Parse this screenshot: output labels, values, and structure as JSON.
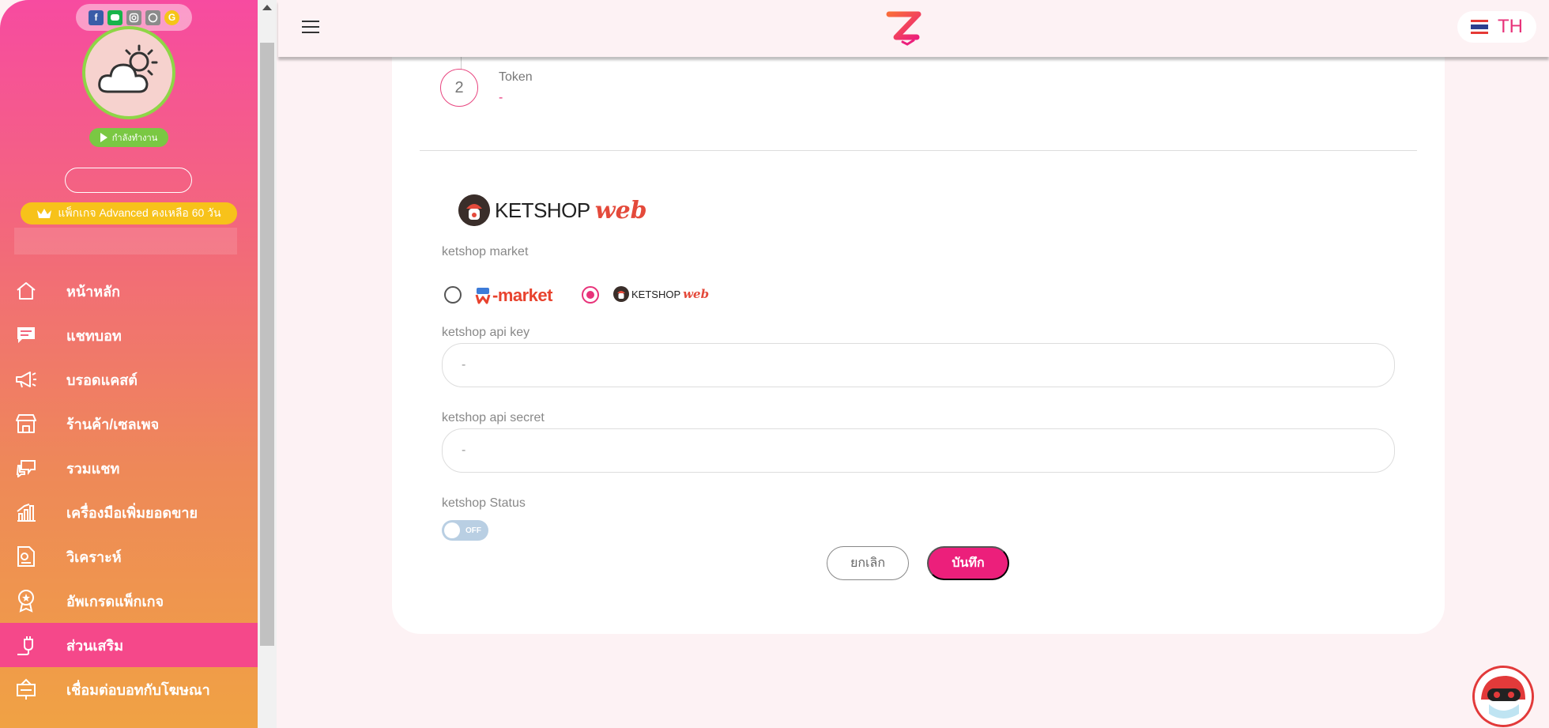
{
  "sidebar": {
    "social_icons": [
      "facebook-icon",
      "line-icon",
      "instagram-icon",
      "whatsapp-icon",
      "google-icon"
    ],
    "status_label": "กำลังทำงาน",
    "package_label": "แพ็กเกจ Advanced คงเหลือ 60 วัน",
    "items": [
      {
        "label": "หน้าหลัก",
        "icon": "home-icon"
      },
      {
        "label": "แชทบอท",
        "icon": "chat-icon"
      },
      {
        "label": "บรอดแคสต์",
        "icon": "megaphone-icon"
      },
      {
        "label": "ร้านค้า/เซลเพจ",
        "icon": "store-icon"
      },
      {
        "label": "รวมแชท",
        "icon": "chats-icon"
      },
      {
        "label": "เครื่องมือเพิ่มยอดขาย",
        "icon": "sales-chart-icon"
      },
      {
        "label": "วิเคราะห์",
        "icon": "analytics-icon"
      },
      {
        "label": "อัพเกรดแพ็กเกจ",
        "icon": "badge-icon"
      },
      {
        "label": "ส่วนเสริม",
        "icon": "plug-icon",
        "active": true
      },
      {
        "label": "เชื่อมต่อบอทกับโฆษณา",
        "icon": "ad-connect-icon"
      }
    ]
  },
  "header": {
    "language": "TH",
    "logo": "Z"
  },
  "step": {
    "number": "2",
    "title": "Token",
    "value": "-"
  },
  "integration": {
    "logo_text": "KETSHOP",
    "logo_web": "web",
    "market_label": "ketshop market",
    "market_options": [
      {
        "name": "-market",
        "selected": false
      },
      {
        "name": "KETSHOP",
        "suffix": "web",
        "selected": true
      }
    ],
    "api_key_label": "ketshop api key",
    "api_key_value": "-",
    "api_secret_label": "ketshop api secret",
    "api_secret_value": "-",
    "status_label": "ketshop Status",
    "status_toggle": "OFF"
  },
  "actions": {
    "cancel_label": "ยกเลิก",
    "save_label": "บันทึก"
  },
  "colors": {
    "accent": "#ec1f7b",
    "sidebar_top": "#f74ba0",
    "sidebar_bottom": "#f0a244",
    "package_pill": "#f7c21a",
    "status_pill": "#7ac843"
  }
}
